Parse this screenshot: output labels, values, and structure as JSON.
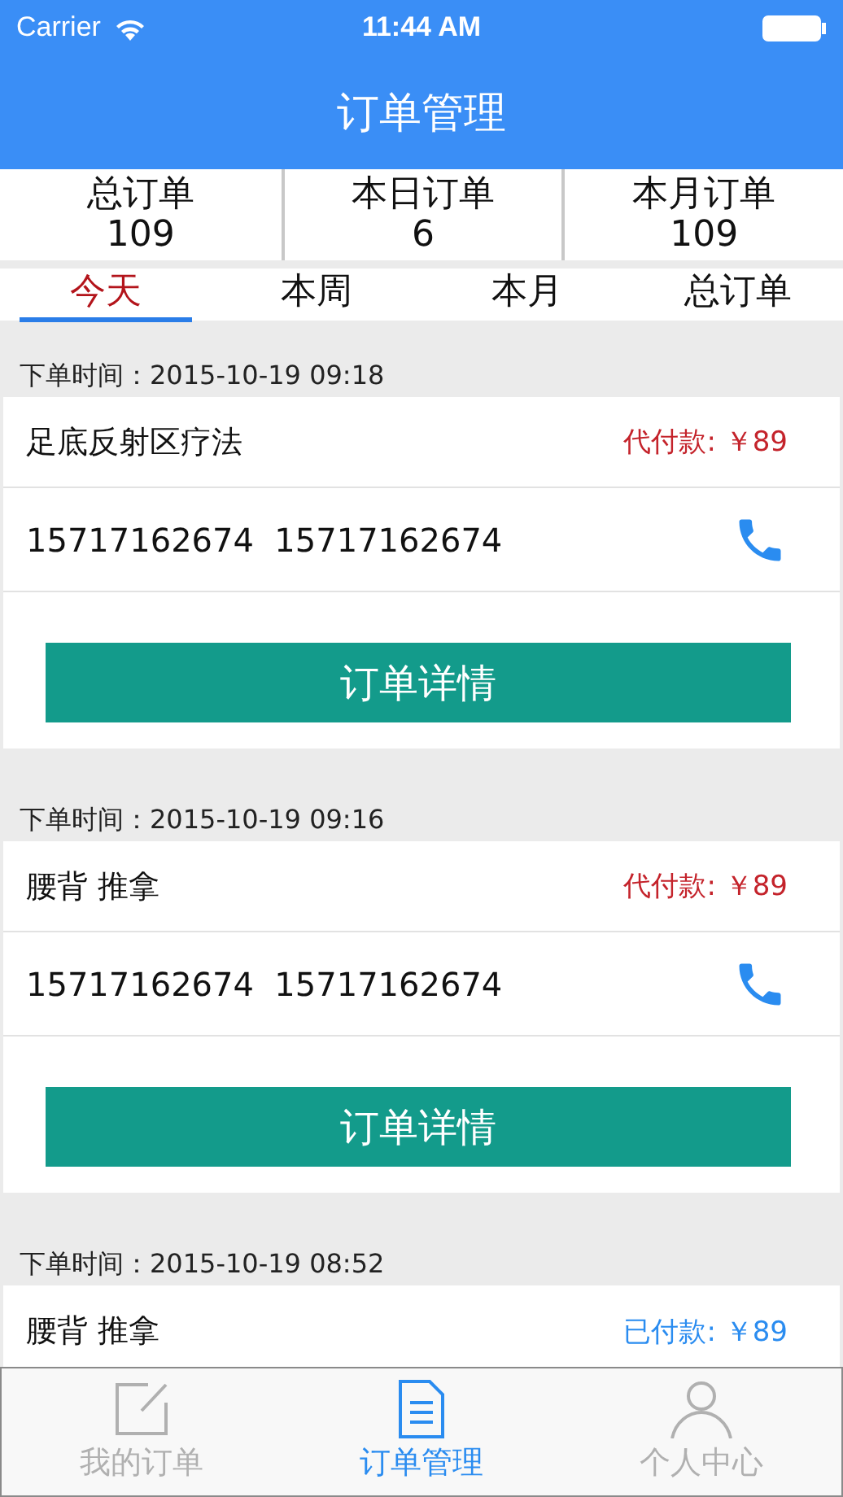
{
  "status_bar": {
    "carrier": "Carrier",
    "time": "11:44 AM"
  },
  "nav": {
    "title": "订单管理"
  },
  "stats": [
    {
      "label": "总订单",
      "value": "109"
    },
    {
      "label": "本日订单",
      "value": "6"
    },
    {
      "label": "本月订单",
      "value": "109"
    }
  ],
  "tabs": [
    {
      "label": "今天",
      "selected": true
    },
    {
      "label": "本周",
      "selected": false
    },
    {
      "label": "本月",
      "selected": false
    },
    {
      "label": "总订单",
      "selected": false
    }
  ],
  "orders": [
    {
      "time": "下单时间：2015-10-19 09:18",
      "service": "足底反射区疗法",
      "payment": "代付款: ￥89",
      "paid": false,
      "phones": "15717162674  15717162674",
      "button": "订单详情"
    },
    {
      "time": "下单时间：2015-10-19 09:16",
      "service": "腰背 推拿",
      "payment": "代付款: ￥89",
      "paid": false,
      "phones": "15717162674  15717162674",
      "button": "订单详情"
    },
    {
      "time": "下单时间：2015-10-19 08:52",
      "service": "腰背 推拿",
      "payment": "已付款: ￥89",
      "paid": true
    }
  ],
  "tab_bar": [
    {
      "label": "我的订单",
      "kind": "edit",
      "selected": false
    },
    {
      "label": "订单管理",
      "kind": "document",
      "selected": true
    },
    {
      "label": "个人中心",
      "kind": "person",
      "selected": false
    }
  ]
}
